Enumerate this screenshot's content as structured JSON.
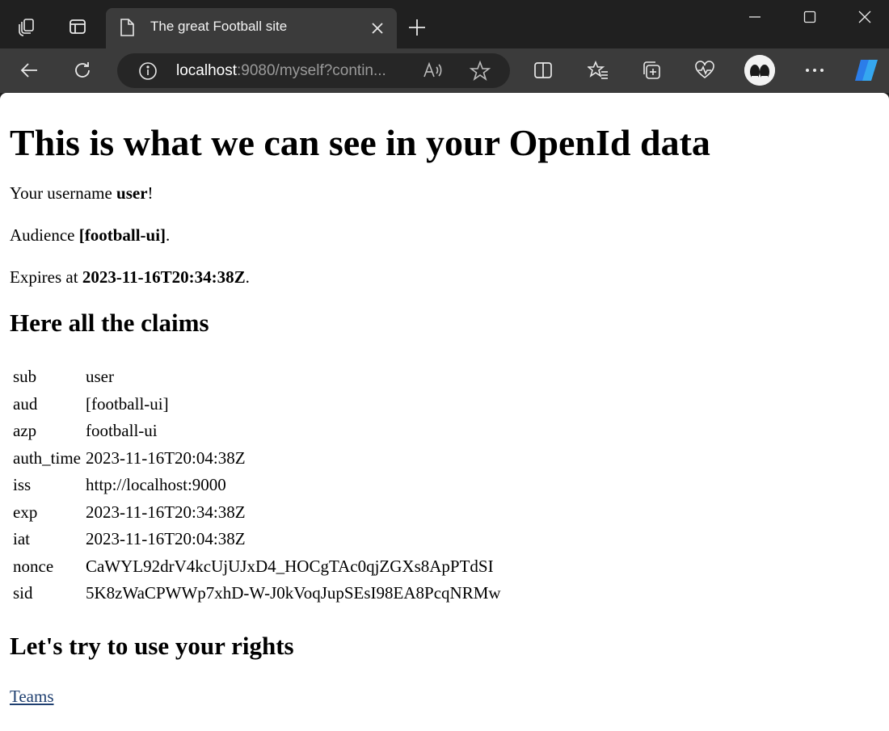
{
  "browser": {
    "tab_title": "The great Football site",
    "url_host": "localhost",
    "url_rest": ":9080/myself?contin..."
  },
  "page": {
    "heading": "This is what we can see in your OpenId data",
    "username_prefix": "Your username ",
    "username": "user",
    "username_suffix": "!",
    "audience_prefix": "Audience ",
    "audience": "[football-ui]",
    "audience_suffix": ".",
    "expires_prefix": "Expires at ",
    "expires": "2023-11-16T20:34:38Z",
    "expires_suffix": ".",
    "claims_heading": "Here all the claims",
    "claims": [
      {
        "key": "sub",
        "value": "user"
      },
      {
        "key": "aud",
        "value": "[football-ui]"
      },
      {
        "key": "azp",
        "value": "football-ui"
      },
      {
        "key": "auth_time",
        "value": "2023-11-16T20:04:38Z"
      },
      {
        "key": "iss",
        "value": "http://localhost:9000"
      },
      {
        "key": "exp",
        "value": "2023-11-16T20:34:38Z"
      },
      {
        "key": "iat",
        "value": "2023-11-16T20:04:38Z"
      },
      {
        "key": "nonce",
        "value": "CaWYL92drV4kcUjUJxD4_HOCgTAc0qjZGXs8ApPTdSI"
      },
      {
        "key": "sid",
        "value": "5K8zWaCPWWp7xhD-W-J0kVoqJupSEsI98EA8PcqNRMw"
      }
    ],
    "rights_heading": "Let's try to use your rights",
    "teams_link": "Teams"
  }
}
